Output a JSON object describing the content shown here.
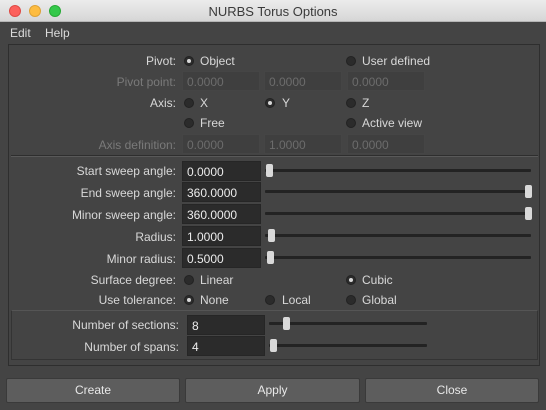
{
  "window": {
    "title": "NURBS Torus Options"
  },
  "menu": {
    "edit": "Edit",
    "help": "Help"
  },
  "pivot": {
    "label": "Pivot:",
    "opt_object": "Object",
    "opt_user": "User defined",
    "selected": "Object"
  },
  "pivot_point": {
    "label": "Pivot point:",
    "x": "0.0000",
    "y": "0.0000",
    "z": "0.0000"
  },
  "axis": {
    "label": "Axis:",
    "opt_x": "X",
    "opt_y": "Y",
    "opt_z": "Z",
    "opt_free": "Free",
    "opt_active": "Active view",
    "selected": "Y"
  },
  "axis_def": {
    "label": "Axis definition:",
    "x": "0.0000",
    "y": "1.0000",
    "z": "0.0000"
  },
  "start_sweep": {
    "label": "Start sweep angle:",
    "value": "0.0000",
    "level": 0
  },
  "end_sweep": {
    "label": "End sweep angle:",
    "value": "360.0000",
    "level": 1
  },
  "minor_sweep": {
    "label": "Minor sweep angle:",
    "value": "360.0000",
    "level": 1
  },
  "radius": {
    "label": "Radius:",
    "value": "1.0000",
    "level": 0.01
  },
  "minor_radius": {
    "label": "Minor radius:",
    "value": "0.5000",
    "level": 0.005
  },
  "surface_degree": {
    "label": "Surface degree:",
    "opt_linear": "Linear",
    "opt_cubic": "Cubic",
    "selected": "Cubic"
  },
  "use_tolerance": {
    "label": "Use tolerance:",
    "opt_none": "None",
    "opt_local": "Local",
    "opt_global": "Global",
    "selected": "None"
  },
  "sections": {
    "label": "Number of sections:",
    "value": "8",
    "level": 0.08
  },
  "spans": {
    "label": "Number of spans:",
    "value": "4",
    "level": 0.02
  },
  "buttons": {
    "create": "Create",
    "apply": "Apply",
    "close": "Close"
  }
}
